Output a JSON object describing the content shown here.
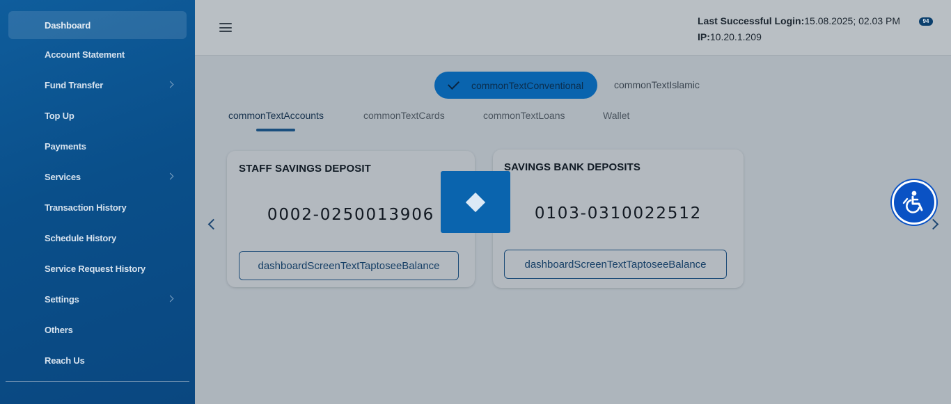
{
  "sidebar": {
    "items": [
      {
        "label": "Dashboard"
      },
      {
        "label": "Account Statement"
      },
      {
        "label": "Fund Transfer"
      },
      {
        "label": "Top Up"
      },
      {
        "label": "Payments"
      },
      {
        "label": "Services"
      },
      {
        "label": "Transaction History"
      },
      {
        "label": "Schedule History"
      },
      {
        "label": "Service Request History"
      },
      {
        "label": "Settings"
      },
      {
        "label": "Others"
      },
      {
        "label": "Reach Us"
      }
    ]
  },
  "header": {
    "login_label": "Last Successful Login:",
    "login_value": "15.08.2025; 02.03 PM",
    "ip_label": "IP:",
    "ip_value": "10.20.1.209",
    "notification_count": "94"
  },
  "segment": {
    "active_label": "commonTextConventional",
    "inactive_label": "commonTextIslamic"
  },
  "tabs": [
    {
      "label": "commonTextAccounts"
    },
    {
      "label": "commonTextCards"
    },
    {
      "label": "commonTextLoans"
    },
    {
      "label": "Wallet"
    }
  ],
  "accounts": [
    {
      "title": "STAFF SAVINGS DEPOSIT",
      "number": "0002-0250013906",
      "button_label": "dashboardScreenTextTaptoseeBalance"
    },
    {
      "title": "SAVINGS BANK DEPOSITS",
      "number": "0103-0310022512",
      "button_label": "dashboardScreenTextTaptoseeBalance"
    }
  ],
  "colors": {
    "sidebar_bg": "#0a4f8a",
    "accent": "#0a64ae",
    "accessibility": "#0a52c4"
  },
  "icons": {
    "menu": "hamburger-icon",
    "check": "check-icon",
    "loader": "diamond-loader-icon",
    "prev": "chevron-left-icon",
    "next": "chevron-right-icon",
    "accessibility": "accessibility-wheelchair-icon"
  }
}
